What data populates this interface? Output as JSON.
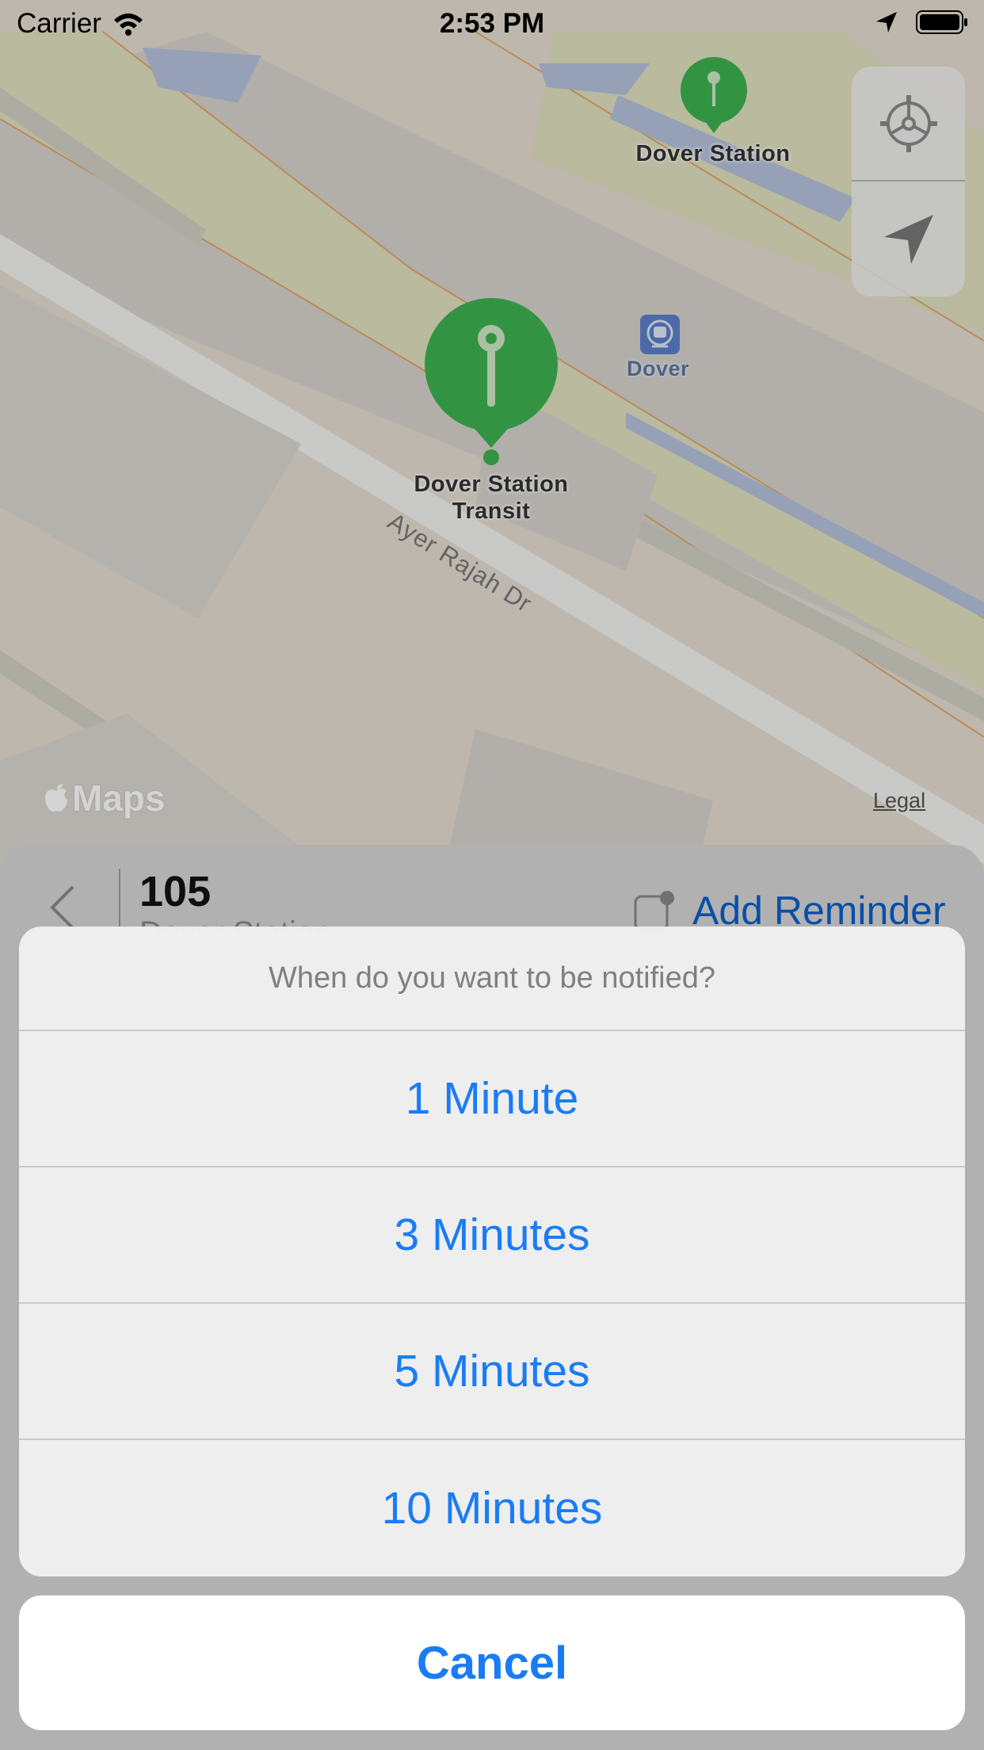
{
  "status_bar": {
    "carrier": "Carrier",
    "time": "2:53 PM"
  },
  "map": {
    "pins": [
      {
        "label": "Dover Station",
        "icon": "pin-icon"
      },
      {
        "label_line1": "Dover Station",
        "label_line2": "Transit",
        "icon": "pin-icon"
      }
    ],
    "metro_label": "Dover",
    "road_label": "Ayer Rajah Dr",
    "maps_brand": "Maps",
    "legal": "Legal",
    "pin_color": "#3db351",
    "controls": [
      "settings-icon",
      "location-arrow-icon"
    ]
  },
  "panel": {
    "route": "105",
    "subtitle": "Dover Station",
    "add_reminder": "Add Reminder"
  },
  "action_sheet": {
    "title": "When do you want to be notified?",
    "options": [
      "1 Minute",
      "3 Minutes",
      "5 Minutes",
      "10 Minutes"
    ],
    "cancel": "Cancel",
    "accent_color": "#1a7cf5"
  }
}
